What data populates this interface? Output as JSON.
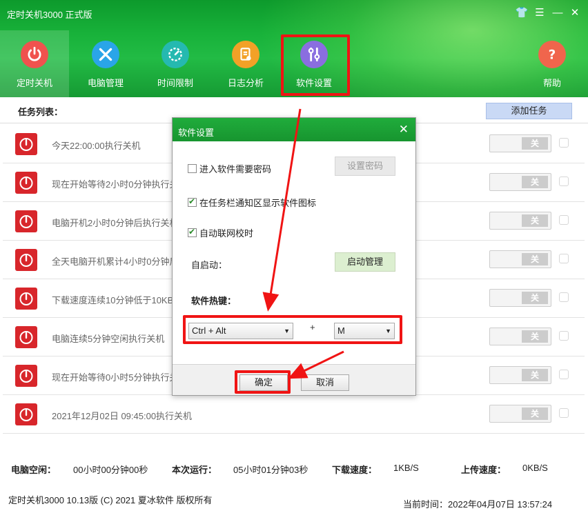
{
  "window": {
    "title": "定时关机3000 正式版",
    "controls": [
      {
        "name": "skin-icon",
        "glyph": "👕"
      },
      {
        "name": "menu-icon",
        "glyph": "☰"
      },
      {
        "name": "minimize-icon",
        "glyph": "—"
      },
      {
        "name": "close-icon",
        "glyph": "✕"
      }
    ]
  },
  "nav": [
    {
      "label": "定时关机",
      "icon": "power-icon",
      "color": "#f0524e",
      "active": true
    },
    {
      "label": "电脑管理",
      "icon": "tools-icon",
      "color": "#2aa5e8",
      "active": false
    },
    {
      "label": "时间限制",
      "icon": "timer-icon",
      "color": "#25b9b0",
      "active": false
    },
    {
      "label": "日志分析",
      "icon": "log-icon",
      "color": "#f2a127",
      "active": false
    },
    {
      "label": "软件设置",
      "icon": "settings-tools-icon",
      "color": "#8a6ee0",
      "active": false
    },
    {
      "label": "帮助",
      "icon": "help-icon",
      "color": "#f0654c",
      "active": false
    }
  ],
  "task_list": {
    "header": "任务列表：",
    "add_button": "添加任务",
    "toggle_off_label": "关",
    "tasks": [
      {
        "text": "今天22:00:00执行关机"
      },
      {
        "text": "现在开始等待2小时0分钟执行关"
      },
      {
        "text": "电脑开机2小时0分钟后执行关机"
      },
      {
        "text": "全天电脑开机累计4小时0分钟后"
      },
      {
        "text": "下载速度连续10分钟低于10KB"
      },
      {
        "text": "电脑连续5分钟空闲执行关机"
      },
      {
        "text": "现在开始等待0小时5分钟执行关"
      },
      {
        "text": "2021年12月02日 09:45:00执行关机"
      }
    ]
  },
  "stats": {
    "idle_label": "电脑空闲：",
    "idle_value": "00小时00分钟00秒",
    "run_label": "本次运行：",
    "run_value": "05小时01分钟03秒",
    "download_label": "下载速度：",
    "download_value": "1KB/S",
    "upload_label": "上传速度：",
    "upload_value": "0KB/S"
  },
  "footer": {
    "copyright": "定时关机3000 10.13版 (C) 2021  夏冰软件 版权所有",
    "current_time": "当前时间：2022年04月07日 13:57:24"
  },
  "dialog": {
    "title": "软件设置",
    "password_check": {
      "label": "进入软件需要密码",
      "checked": false
    },
    "set_password_button": "设置密码",
    "tray_check": {
      "label": "在任务栏通知区显示软件图标",
      "checked": true
    },
    "time_sync_check": {
      "label": "自动联网校时",
      "checked": true
    },
    "autostart_label": "自启动：",
    "autostart_button": "启动管理",
    "hotkey_label": "软件热键：",
    "hotkey_modifier": "Ctrl + Alt",
    "hotkey_plus": "+",
    "hotkey_key": "M",
    "ok_button": "确定",
    "cancel_button": "取消"
  },
  "annotations": {
    "highlight_color": "#f01414"
  }
}
